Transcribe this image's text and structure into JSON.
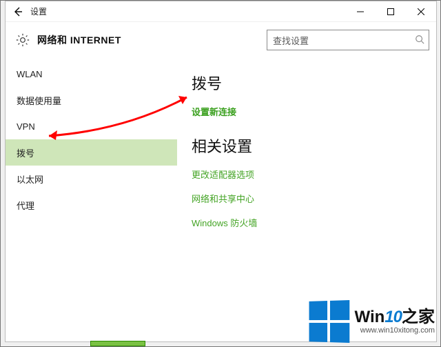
{
  "titlebar": {
    "title": "设置"
  },
  "header": {
    "title": "网络和 INTERNET",
    "search_placeholder": "查找设置"
  },
  "sidebar": {
    "items": [
      {
        "label": "WLAN"
      },
      {
        "label": "数据使用量"
      },
      {
        "label": "VPN"
      },
      {
        "label": "拨号"
      },
      {
        "label": "以太网"
      },
      {
        "label": "代理"
      }
    ],
    "selected_index": 3
  },
  "content": {
    "section1_title": "拨号",
    "new_connection_link": "设置新连接",
    "section2_title": "相关设置",
    "links": [
      "更改适配器选项",
      "网络和共享中心",
      "Windows 防火墙"
    ]
  },
  "watermark": {
    "brand_prefix": "Win",
    "brand_number": "10",
    "brand_suffix": "之家",
    "url": "www.win10xitong.com"
  }
}
